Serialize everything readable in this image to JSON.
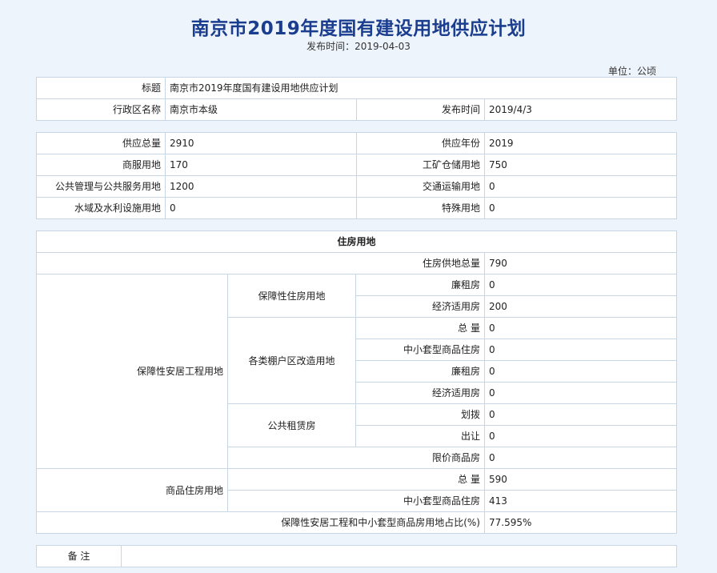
{
  "title": "南京市2019年度国有建设用地供应计划",
  "publish_line": "发布时间：2019-04-03",
  "unit": "单位：公顷",
  "basic": {
    "title_label": "标题",
    "title_value": "南京市2019年度国有建设用地供应计划",
    "region_label": "行政区名称",
    "region_value": "南京市本级",
    "date_label": "发布时间",
    "date_value": "2019/4/3"
  },
  "supply": {
    "total_label": "供应总量",
    "total_value": "2910",
    "year_label": "供应年份",
    "year_value": "2019",
    "commercial_label": "商服用地",
    "commercial_value": "170",
    "industrial_label": "工矿仓储用地",
    "industrial_value": "750",
    "public_label": "公共管理与公共服务用地",
    "public_value": "1200",
    "transport_label": "交通运输用地",
    "transport_value": "0",
    "water_label": "水域及水利设施用地",
    "water_value": "0",
    "special_label": "特殊用地",
    "special_value": "0"
  },
  "housing": {
    "header": "住房用地",
    "total_label": "住房供地总量",
    "total_value": "790",
    "affordable_group": "保障性安居工程用地",
    "guarantee_label": "保障性住房用地",
    "low_rent_label": "廉租房",
    "low_rent_value": "0",
    "economy_label": "经济适用房",
    "economy_value": "200",
    "shanty_label": "各类棚户区改造用地",
    "shanty_total_label": "总 量",
    "shanty_total_value": "0",
    "shanty_small_label": "中小套型商品住房",
    "shanty_small_value": "0",
    "shanty_low_rent_label": "廉租房",
    "shanty_low_rent_value": "0",
    "shanty_economy_label": "经济适用房",
    "shanty_economy_value": "0",
    "public_rent_label": "公共租赁房",
    "allocate_label": "划拨",
    "allocate_value": "0",
    "transfer_label": "出让",
    "transfer_value": "0",
    "limited_label": "限价商品房",
    "limited_value": "0",
    "commercial_group": "商品住房用地",
    "commercial_total_label": "总 量",
    "commercial_total_value": "590",
    "commercial_small_label": "中小套型商品住房",
    "commercial_small_value": "413",
    "ratio_label": "保障性安居工程和中小套型商品房用地占比(%)",
    "ratio_value": "77.595%"
  },
  "remarks": {
    "label": "备 注",
    "value": ""
  }
}
